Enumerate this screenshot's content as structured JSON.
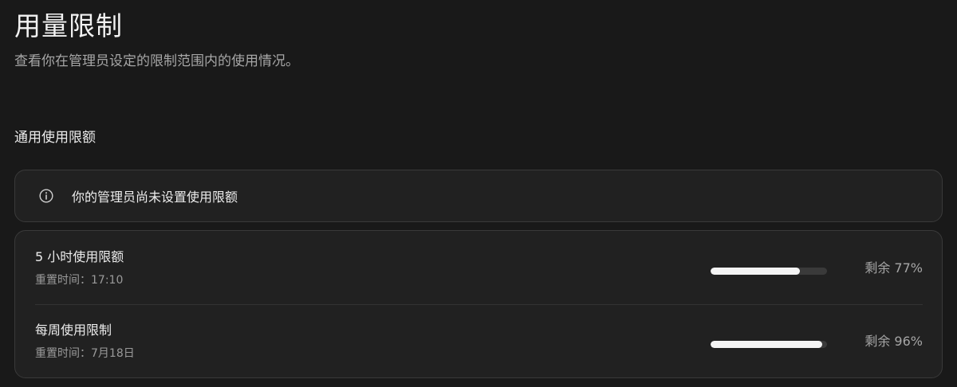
{
  "header": {
    "title": "用量限制",
    "subtitle": "查看你在管理员设定的限制范围内的使用情况。"
  },
  "section": {
    "title": "通用使用限额"
  },
  "notice": {
    "icon": "info-icon",
    "text": "你的管理员尚未设置使用限额"
  },
  "limits": [
    {
      "name": "5 小时使用限额",
      "reset": "重置时间：17:10",
      "remaining_percent": 77,
      "remaining_label": "剩余 77%"
    },
    {
      "name": "每周使用限制",
      "reset": "重置时间：7月18日",
      "remaining_percent": 96,
      "remaining_label": "剩余 96%"
    }
  ],
  "colors": {
    "background": "#191919",
    "card": "#212121",
    "border": "#3a3a3a",
    "progress_fill": "#f4f4f4",
    "progress_track": "#3a3a3a"
  }
}
